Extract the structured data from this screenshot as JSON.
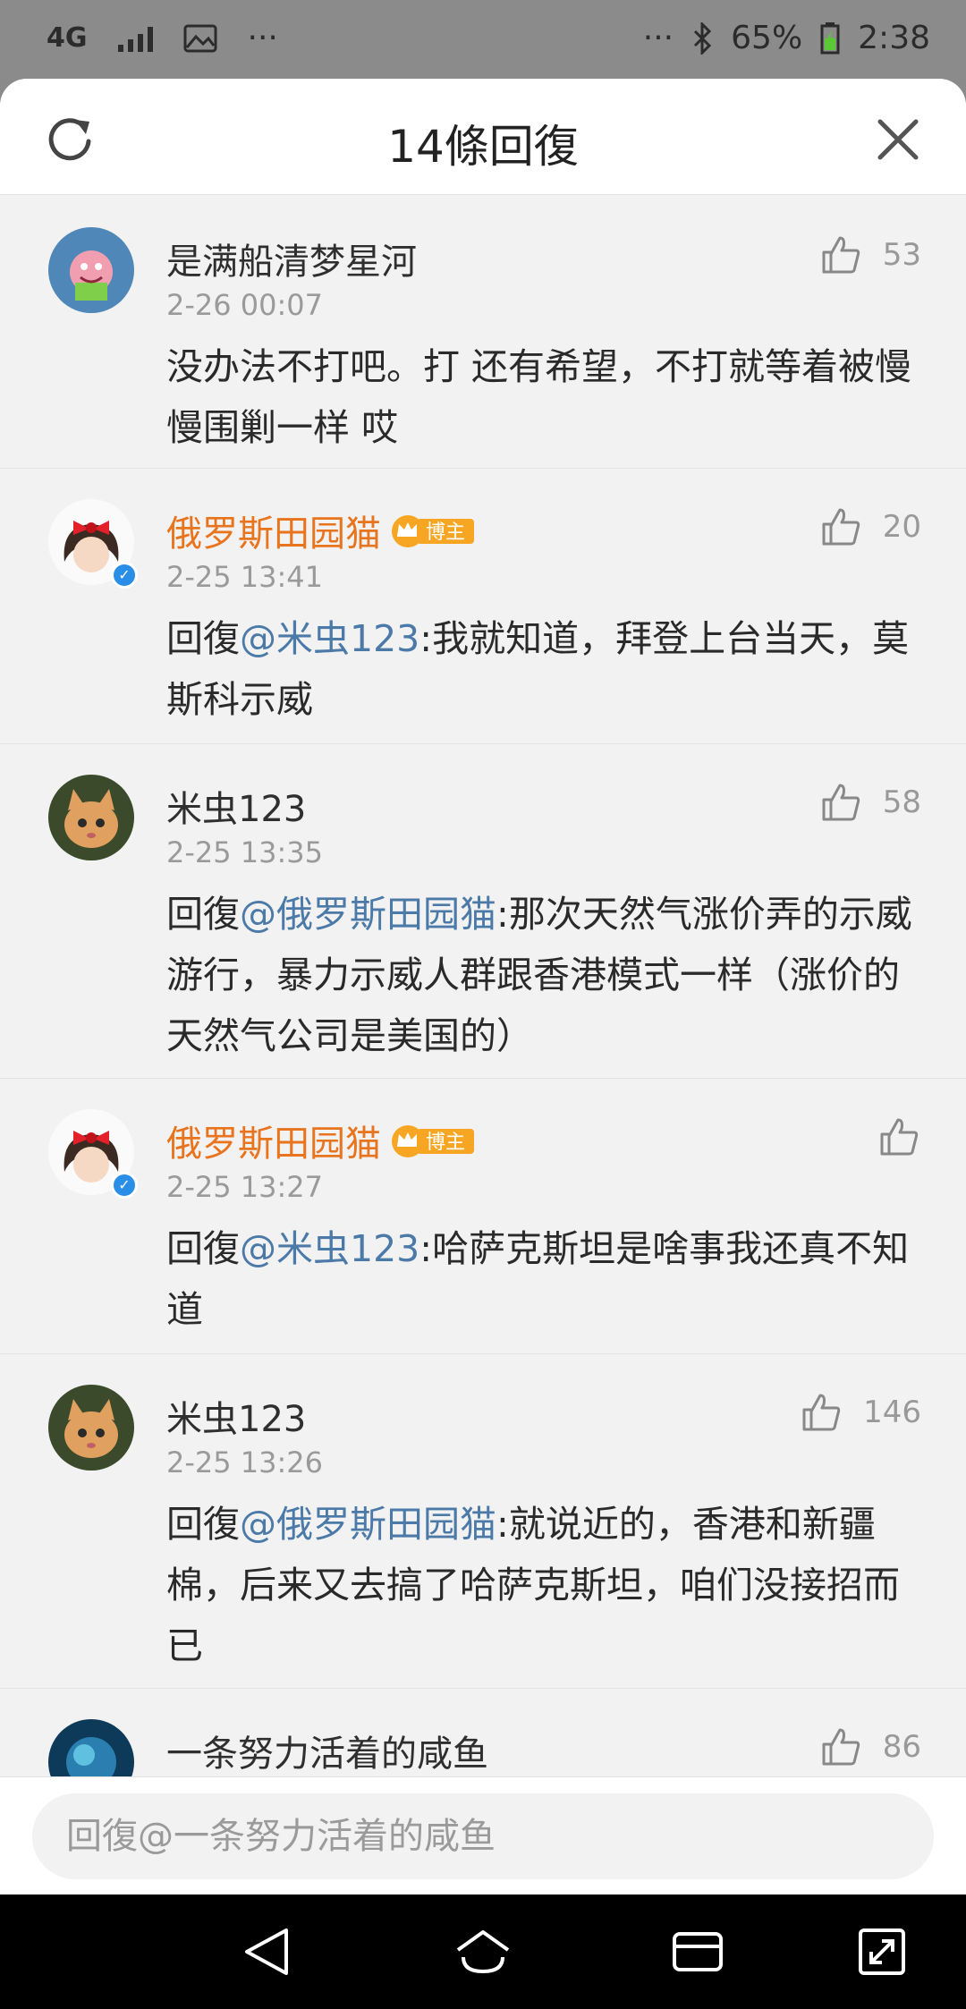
{
  "status_bar": {
    "network": "4G",
    "left_dots": "···",
    "right_dots": "···",
    "battery": "65%",
    "time": "2:38"
  },
  "header": {
    "title": "14條回復"
  },
  "colors": {
    "owner_name": "#e8741e",
    "mention": "#4c7aa8",
    "badge": "#f6a623"
  },
  "comments": [
    {
      "user": "是满船清梦星河",
      "time": "2-26 00:07",
      "likes": "53",
      "is_owner": false,
      "text": "没办法不打吧。打 还有希望，不打就等着被慢慢围剿一样 哎"
    },
    {
      "user": "俄罗斯田园猫",
      "badge": "博主",
      "time": "2-25 13:41",
      "likes": "20",
      "is_owner": true,
      "prefix": "回復",
      "mention": "@米虫123",
      "text": ":我就知道，拜登上台当天，莫斯科示威"
    },
    {
      "user": "米虫123",
      "time": "2-25 13:35",
      "likes": "58",
      "is_owner": false,
      "prefix": "回復",
      "mention": "@俄罗斯田园猫",
      "text": ":那次天然气涨价弄的示威游行，暴力示威人群跟香港模式一样（涨价的天然气公司是美国的）"
    },
    {
      "user": "俄罗斯田园猫",
      "badge": "博主",
      "time": "2-25 13:27",
      "likes": "",
      "is_owner": true,
      "prefix": "回復",
      "mention": "@米虫123",
      "text": ":哈萨克斯坦是啥事我还真不知道"
    },
    {
      "user": "米虫123",
      "time": "2-25 13:26",
      "likes": "146",
      "is_owner": false,
      "prefix": "回復",
      "mention": "@俄罗斯田园猫",
      "text": ":就说近的，香港和新疆棉，后来又去搞了哈萨克斯坦，咱们没接招而已"
    },
    {
      "user": "一条努力活着的咸鱼",
      "likes": "86",
      "is_owner": false
    }
  ],
  "reply": {
    "placeholder": "回復@一条努力活着的咸鱼"
  },
  "icons": [
    "refresh-icon",
    "close-icon",
    "thumb-up-icon",
    "back-icon",
    "home-icon",
    "recents-icon",
    "expand-icon",
    "bluetooth-icon",
    "battery-icon",
    "signal-icon",
    "image-icon"
  ]
}
